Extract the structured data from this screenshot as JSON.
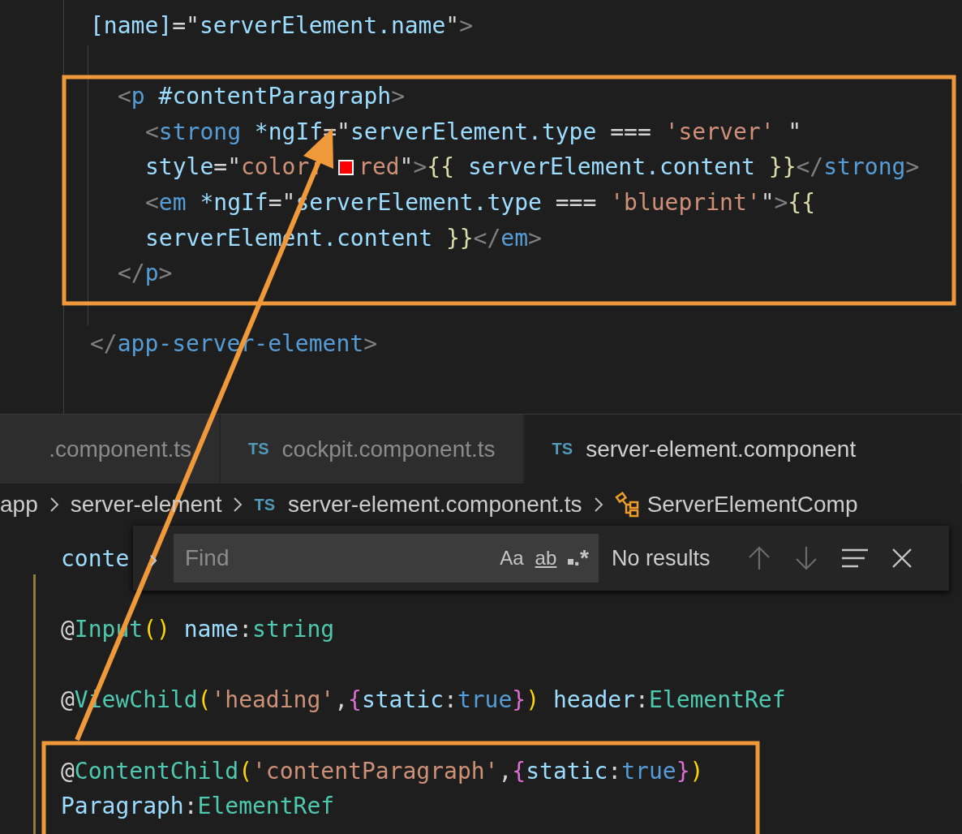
{
  "top_editor": {
    "lines": [
      {
        "kind": "code",
        "tokens": [
          {
            "kind": "attr",
            "text": "[name]"
          },
          {
            "kind": "plain",
            "text": "=\""
          },
          {
            "kind": "var",
            "text": "serverElement.name"
          },
          {
            "kind": "plain",
            "text": "\""
          },
          {
            "kind": "punct",
            "text": ">"
          }
        ]
      },
      {
        "kind": "blank"
      },
      {
        "kind": "group",
        "children": [
          {
            "kind": "code",
            "tokens": [
              {
                "kind": "punct",
                "text": "<"
              },
              {
                "kind": "tag",
                "text": "p"
              },
              {
                "kind": "attr",
                "text": " #contentParagraph"
              },
              {
                "kind": "punct",
                "text": ">"
              }
            ],
            "children": [
              {
                "kind": "code",
                "tokens": [
                  {
                    "kind": "punct",
                    "text": "<"
                  },
                  {
                    "kind": "tag",
                    "text": "strong"
                  },
                  {
                    "kind": "attr",
                    "text": " *ngIf"
                  },
                  {
                    "kind": "plain",
                    "text": "=\""
                  },
                  {
                    "kind": "var",
                    "text": "serverElement.type"
                  },
                  {
                    "kind": "plain",
                    "text": " === "
                  },
                  {
                    "kind": "str",
                    "text": "'server'"
                  },
                  {
                    "kind": "plain",
                    "text": " \""
                  }
                ]
              },
              {
                "kind": "code",
                "tokens": [
                  {
                    "kind": "attr",
                    "text": "style"
                  },
                  {
                    "kind": "plain",
                    "text": "=\""
                  },
                  {
                    "kind": "str",
                    "text": "color: "
                  },
                  {
                    "kind": "swatch",
                    "color": "#ff0000"
                  },
                  {
                    "kind": "str",
                    "text": "red"
                  },
                  {
                    "kind": "plain",
                    "text": "\""
                  },
                  {
                    "kind": "punct",
                    "text": ">"
                  },
                  {
                    "kind": "brace",
                    "text": "{{"
                  },
                  {
                    "kind": "var",
                    "text": " serverElement.content "
                  },
                  {
                    "kind": "brace",
                    "text": "}}"
                  },
                  {
                    "kind": "punct",
                    "text": "</"
                  },
                  {
                    "kind": "tag",
                    "text": "strong"
                  },
                  {
                    "kind": "punct",
                    "text": ">"
                  }
                ]
              },
              {
                "kind": "code",
                "tokens": [
                  {
                    "kind": "punct",
                    "text": "<"
                  },
                  {
                    "kind": "tag",
                    "text": "em"
                  },
                  {
                    "kind": "attr",
                    "text": " *ngIf"
                  },
                  {
                    "kind": "plain",
                    "text": "=\""
                  },
                  {
                    "kind": "var",
                    "text": "serverElement.type"
                  },
                  {
                    "kind": "plain",
                    "text": " === "
                  },
                  {
                    "kind": "str",
                    "text": "'blueprint'"
                  },
                  {
                    "kind": "plain",
                    "text": "\""
                  },
                  {
                    "kind": "punct",
                    "text": ">"
                  },
                  {
                    "kind": "brace",
                    "text": "{{"
                  }
                ]
              },
              {
                "kind": "code",
                "tokens": [
                  {
                    "kind": "var",
                    "text": "serverElement.content "
                  },
                  {
                    "kind": "brace",
                    "text": "}}"
                  },
                  {
                    "kind": "punct",
                    "text": "</"
                  },
                  {
                    "kind": "tag",
                    "text": "em"
                  },
                  {
                    "kind": "punct",
                    "text": ">"
                  }
                ]
              }
            ]
          },
          {
            "kind": "code",
            "tokens": [
              {
                "kind": "punct",
                "text": "</"
              },
              {
                "kind": "tag",
                "text": "p"
              },
              {
                "kind": "punct",
                "text": ">"
              }
            ]
          }
        ]
      },
      {
        "kind": "blank"
      },
      {
        "kind": "code",
        "tokens": [
          {
            "kind": "punct",
            "text": "</"
          },
          {
            "kind": "tag",
            "text": "app-server-element"
          },
          {
            "kind": "punct",
            "text": ">"
          }
        ]
      }
    ]
  },
  "tabs": [
    {
      "label": ".component.ts",
      "selected": false
    },
    {
      "badge": "TS",
      "label": "cockpit.component.ts",
      "selected": false
    },
    {
      "badge": "TS",
      "label": "server-element.component",
      "selected": true
    }
  ],
  "breadcrumb": [
    {
      "kind": "folder",
      "label": "app"
    },
    {
      "kind": "folder",
      "label": "server-element"
    },
    {
      "kind": "file",
      "badge": "TS",
      "label": "server-element.component.ts"
    },
    {
      "kind": "symbol",
      "label": "ServerElementComp"
    }
  ],
  "bottom_editor": {
    "lines": [
      {
        "kind": "code",
        "tokens": [
          {
            "kind": "var",
            "text": "conte"
          }
        ]
      },
      {
        "kind": "blank"
      },
      {
        "kind": "code",
        "tokens": [
          {
            "kind": "plain",
            "text": "@"
          },
          {
            "kind": "type",
            "text": "Input"
          },
          {
            "kind": "paren",
            "text": "()"
          },
          {
            "kind": "var",
            "text": " name"
          },
          {
            "kind": "plain",
            "text": ":"
          },
          {
            "kind": "type",
            "text": "string"
          }
        ]
      },
      {
        "kind": "blank"
      },
      {
        "kind": "code",
        "tokens": [
          {
            "kind": "plain",
            "text": "@"
          },
          {
            "kind": "type",
            "text": "ViewChild"
          },
          {
            "kind": "paren",
            "text": "("
          },
          {
            "kind": "str",
            "text": "'heading'"
          },
          {
            "kind": "plain",
            "text": ","
          },
          {
            "kind": "brace2",
            "text": "{"
          },
          {
            "kind": "var",
            "text": "static"
          },
          {
            "kind": "plain",
            "text": ":"
          },
          {
            "kind": "kw",
            "text": "true"
          },
          {
            "kind": "brace2",
            "text": "}"
          },
          {
            "kind": "paren",
            "text": ")"
          },
          {
            "kind": "var",
            "text": " header"
          },
          {
            "kind": "plain",
            "text": ":"
          },
          {
            "kind": "type",
            "text": "ElementRef"
          }
        ]
      },
      {
        "kind": "blank"
      },
      {
        "kind": "code",
        "tokens": [
          {
            "kind": "plain",
            "text": "@"
          },
          {
            "kind": "type",
            "text": "ContentChild"
          },
          {
            "kind": "paren",
            "text": "("
          },
          {
            "kind": "str",
            "text": "'contentParagraph'"
          },
          {
            "kind": "plain",
            "text": ","
          },
          {
            "kind": "brace2",
            "text": "{"
          },
          {
            "kind": "var",
            "text": "static"
          },
          {
            "kind": "plain",
            "text": ":"
          },
          {
            "kind": "kw",
            "text": "true"
          },
          {
            "kind": "brace2",
            "text": "}"
          },
          {
            "kind": "paren",
            "text": ")"
          }
        ]
      },
      {
        "kind": "code",
        "tokens": [
          {
            "kind": "var",
            "text": "Paragraph"
          },
          {
            "kind": "plain",
            "text": ":"
          },
          {
            "kind": "type",
            "text": "ElementRef"
          }
        ]
      }
    ]
  },
  "find_widget": {
    "toggle": "›",
    "placeholder": "Find",
    "options": [
      {
        "kind": "case",
        "label": "Aa"
      },
      {
        "kind": "word",
        "label": "ab"
      },
      {
        "kind": "regex",
        "label": ".*"
      }
    ],
    "result": "No results"
  }
}
